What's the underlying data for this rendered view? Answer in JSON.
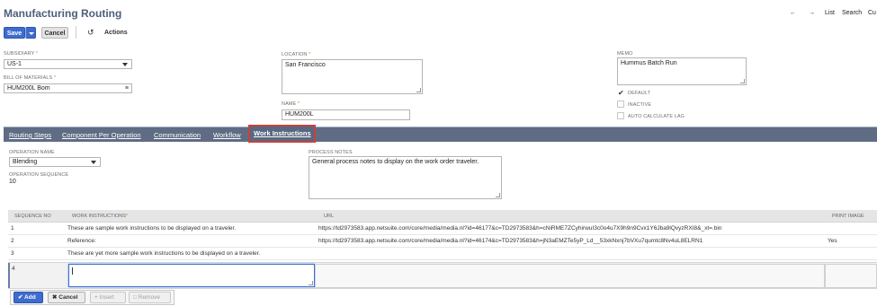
{
  "header": {
    "title": "Manufacturing Routing",
    "nav": {
      "back_icon": "arrow-left-icon",
      "forward_icon": "arrow-right-icon",
      "list": "List",
      "search": "Search",
      "customize": "Cu"
    }
  },
  "toolbar": {
    "save": "Save",
    "cancel": "Cancel",
    "actions": "Actions"
  },
  "fields": {
    "subsidiary": {
      "label": "SUBSIDIARY",
      "value": "US-1"
    },
    "bom": {
      "label": "BILL OF MATERIALS",
      "value": "HUM200L Bom"
    },
    "location": {
      "label": "LOCATION",
      "value": "San Francisco"
    },
    "name": {
      "label": "NAME",
      "value": "HUM200L"
    },
    "memo": {
      "label": "MEMO",
      "value": "Hummus Batch Run"
    },
    "default": {
      "label": "DEFAULT",
      "checked": true
    },
    "inactive": {
      "label": "INACTIVE",
      "checked": false
    },
    "auto_lag": {
      "label": "AUTO CALCULATE LAG",
      "checked": false
    }
  },
  "tabs": [
    "Routing Steps",
    "Component Per Operation",
    "Communication",
    "Workflow",
    "Work Instructions"
  ],
  "active_tab": "Work Instructions",
  "operation": {
    "name_label": "OPERATION NAME",
    "name_value": "Blending",
    "seq_label": "OPERATION SEQUENCE",
    "seq_value": "10",
    "notes_label": "PROCESS NOTES",
    "notes_value": "General process notes to display on the work order traveler."
  },
  "grid": {
    "columns": [
      "SEQUENCE NO",
      "WORK INSTRUCTIONS",
      "URL",
      "PRINT IMAGE"
    ],
    "rows": [
      {
        "seq": "1",
        "instructions": "These are sample work instructions to be displayed on a traveler.",
        "url": "https://td2973583.app.netsuite.com/core/media/media.nl?id=46177&c=TD2973583&h=cNiRME7ZCyhirwuI3c0o4u7X9h9n9Cvx1Y6Jba9lQvyzRXI8&_xt=.bin",
        "print": ""
      },
      {
        "seq": "2",
        "instructions": "Reference:",
        "url": "https://td2973583.app.netsuite.com/core/media/media.nl?id=46174&c=TD2973583&h=jN3aEMZTe5yP_Ld__53xkNxnj7bVXu7qumtc8Nv4uL8ELRN1",
        "print": "Yes"
      },
      {
        "seq": "3",
        "instructions": "These are yet more sample work instructions to be displayed on a traveler.",
        "url": "",
        "print": ""
      }
    ],
    "edit_row": {
      "seq": "4"
    }
  },
  "grid_buttons": {
    "add": "Add",
    "cancel": "Cancel",
    "insert": "Insert",
    "remove": "Remove"
  }
}
